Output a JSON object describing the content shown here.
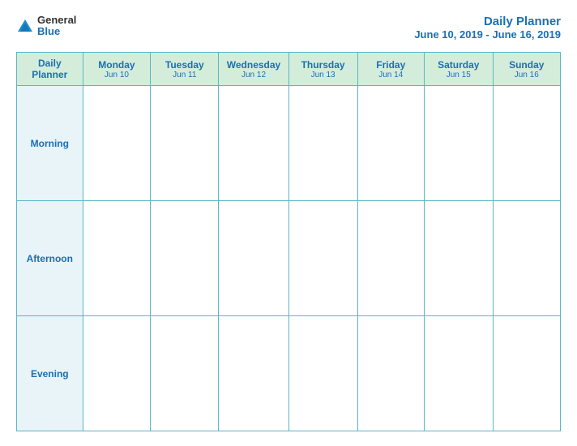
{
  "header": {
    "logo_general": "General",
    "logo_blue": "Blue",
    "title_main": "Daily Planner",
    "title_sub": "June 10, 2019 - June 16, 2019"
  },
  "table": {
    "columns": [
      {
        "id": "label",
        "name": "Daily\nPlanner",
        "date": ""
      },
      {
        "id": "mon",
        "name": "Monday",
        "date": "Jun 10"
      },
      {
        "id": "tue",
        "name": "Tuesday",
        "date": "Jun 11"
      },
      {
        "id": "wed",
        "name": "Wednesday",
        "date": "Jun 12"
      },
      {
        "id": "thu",
        "name": "Thursday",
        "date": "Jun 13"
      },
      {
        "id": "fri",
        "name": "Friday",
        "date": "Jun 14"
      },
      {
        "id": "sat",
        "name": "Saturday",
        "date": "Jun 15"
      },
      {
        "id": "sun",
        "name": "Sunday",
        "date": "Jun 16"
      }
    ],
    "rows": [
      {
        "id": "morning",
        "label": "Morning"
      },
      {
        "id": "afternoon",
        "label": "Afternoon"
      },
      {
        "id": "evening",
        "label": "Evening"
      }
    ]
  }
}
